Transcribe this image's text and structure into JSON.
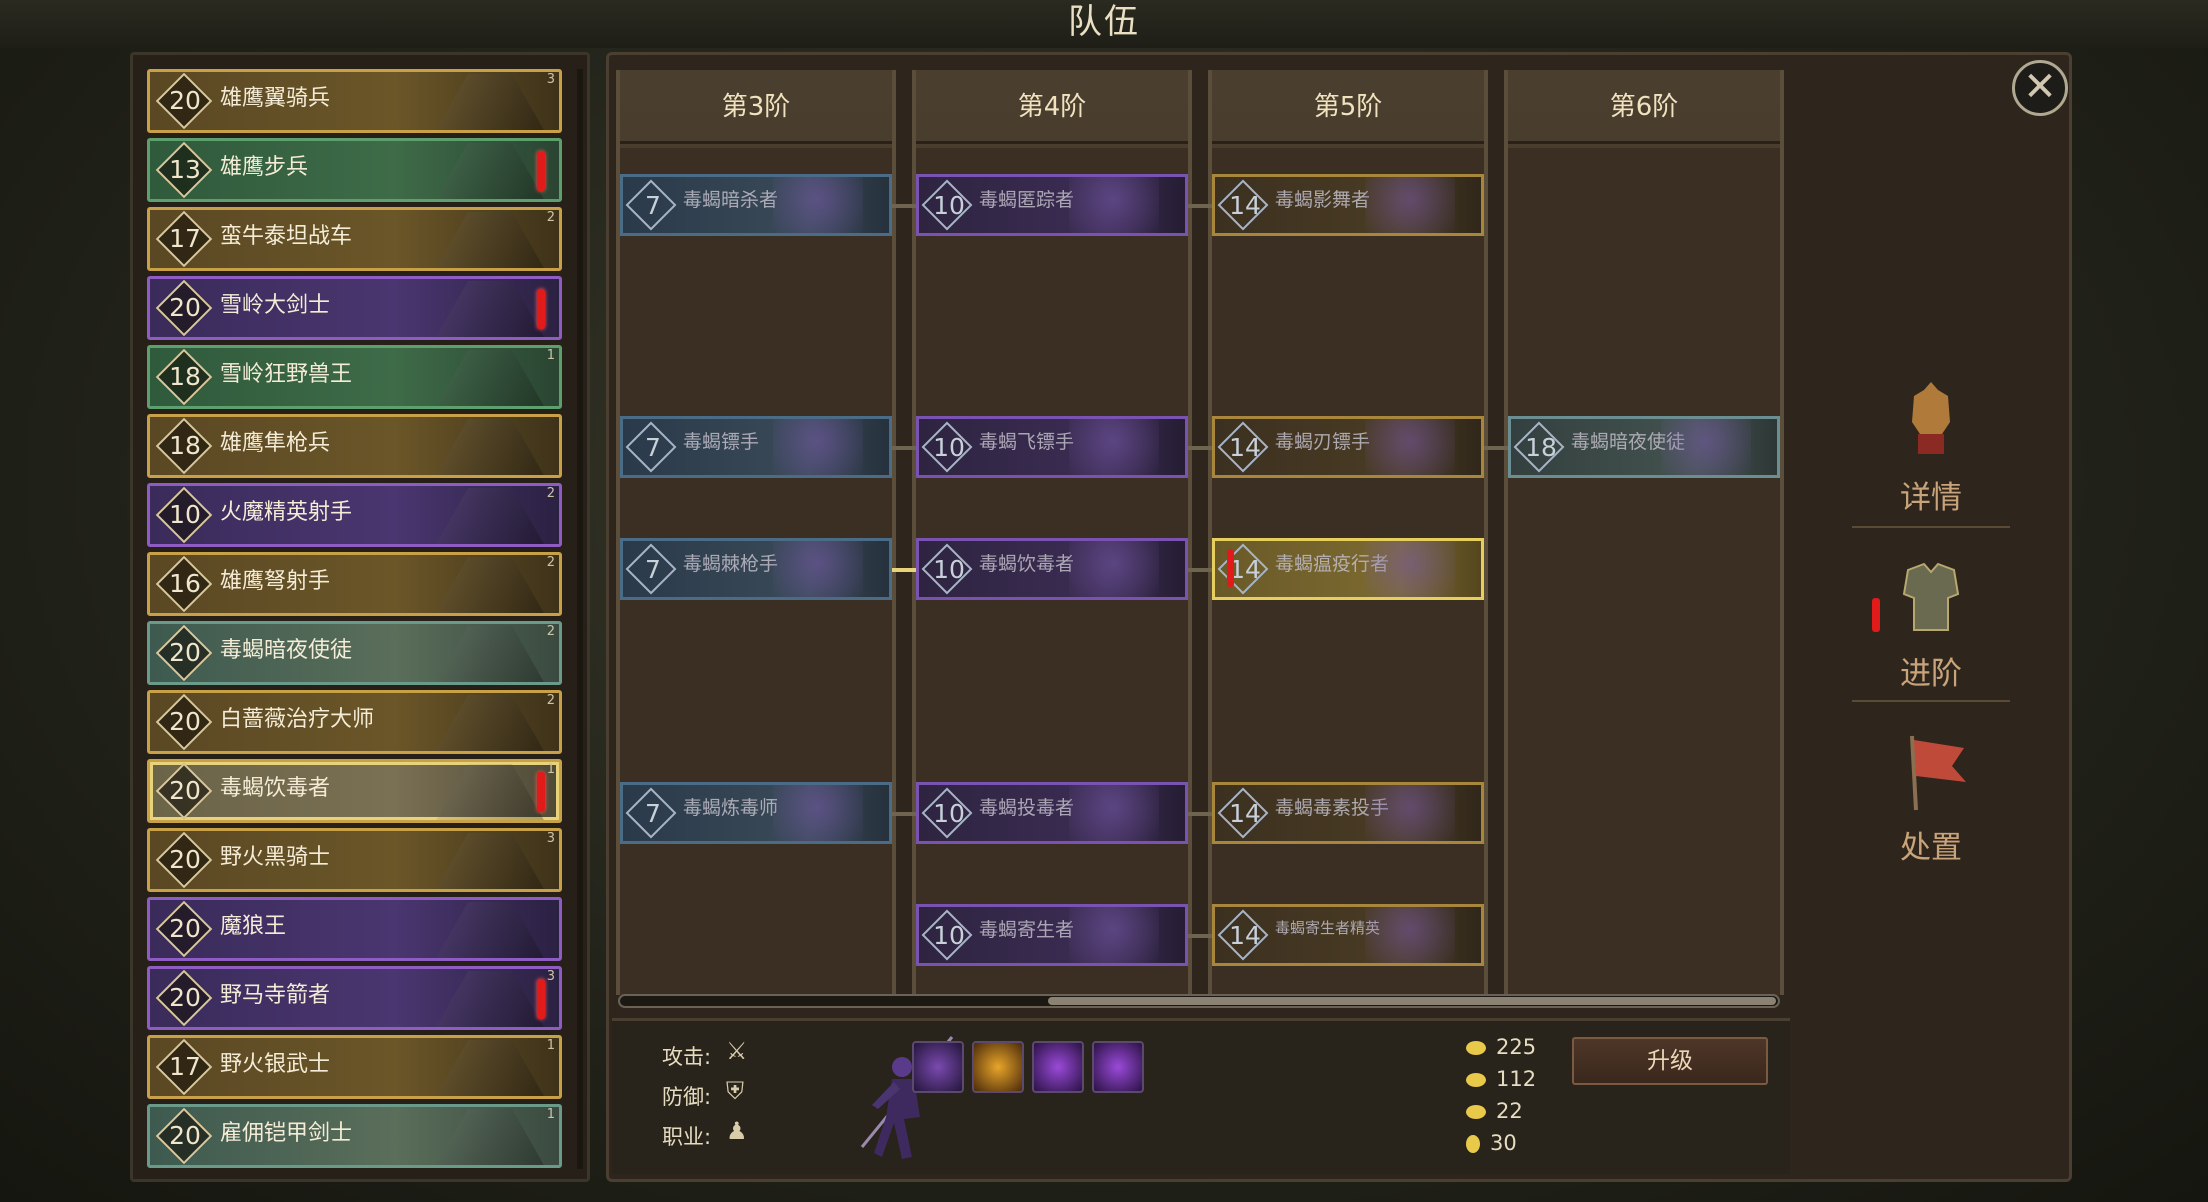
{
  "header": {
    "title": "队伍"
  },
  "roster": [
    {
      "level": "20",
      "name": "雄鹰翼骑兵",
      "stars": "3",
      "rarity": "gold",
      "alert": false
    },
    {
      "level": "13",
      "name": "雄鹰步兵",
      "stars": "",
      "rarity": "green",
      "alert": true
    },
    {
      "level": "17",
      "name": "蛮牛泰坦战车",
      "stars": "2",
      "rarity": "gold",
      "alert": false
    },
    {
      "level": "20",
      "name": "雪岭大剑士",
      "stars": "",
      "rarity": "purple",
      "alert": true
    },
    {
      "level": "18",
      "name": "雪岭狂野兽王",
      "stars": "1",
      "rarity": "green",
      "alert": false
    },
    {
      "level": "18",
      "name": "雄鹰隼枪兵",
      "stars": "",
      "rarity": "gold",
      "alert": false
    },
    {
      "level": "10",
      "name": "火魔精英射手",
      "stars": "2",
      "rarity": "purple",
      "alert": false
    },
    {
      "level": "16",
      "name": "雄鹰弩射手",
      "stars": "2",
      "rarity": "gold",
      "alert": false
    },
    {
      "level": "20",
      "name": "毒蝎暗夜使徒",
      "stars": "2",
      "rarity": "teal",
      "alert": false
    },
    {
      "level": "20",
      "name": "白蔷薇治疗大师",
      "stars": "2",
      "rarity": "gold",
      "alert": false
    },
    {
      "level": "20",
      "name": "毒蝎饮毒者",
      "stars": "1",
      "rarity": "selected",
      "alert": true
    },
    {
      "level": "20",
      "name": "野火黑骑士",
      "stars": "3",
      "rarity": "gold",
      "alert": false
    },
    {
      "level": "20",
      "name": "魔狼王",
      "stars": "",
      "rarity": "purple",
      "alert": false
    },
    {
      "level": "20",
      "name": "野马寺箭者",
      "stars": "3",
      "rarity": "purple",
      "alert": true
    },
    {
      "level": "17",
      "name": "野火银武士",
      "stars": "1",
      "rarity": "gold",
      "alert": false
    },
    {
      "level": "20",
      "name": "雇佣铠甲剑士",
      "stars": "1",
      "rarity": "teal",
      "alert": false
    }
  ],
  "tiers": [
    {
      "label": "第3阶",
      "nodes": [
        {
          "level": "7",
          "name": "毒蝎暗杀者",
          "row": 0,
          "style": ""
        },
        {
          "level": "7",
          "name": "毒蝎镖手",
          "row": 2,
          "style": ""
        },
        {
          "level": "7",
          "name": "毒蝎棘枪手",
          "row": 3,
          "style": ""
        },
        {
          "level": "7",
          "name": "毒蝎炼毒师",
          "row": 5,
          "style": ""
        }
      ]
    },
    {
      "label": "第4阶",
      "nodes": [
        {
          "level": "10",
          "name": "毒蝎匿踪者",
          "row": 0,
          "style": "purple"
        },
        {
          "level": "10",
          "name": "毒蝎飞镖手",
          "row": 2,
          "style": "purple"
        },
        {
          "level": "10",
          "name": "毒蝎饮毒者",
          "row": 3,
          "style": "purple"
        },
        {
          "level": "10",
          "name": "毒蝎投毒者",
          "row": 5,
          "style": "purple"
        },
        {
          "level": "10",
          "name": "毒蝎寄生者",
          "row": 6,
          "style": "purple"
        }
      ]
    },
    {
      "label": "第5阶",
      "nodes": [
        {
          "level": "14",
          "name": "毒蝎影舞者",
          "row": 0,
          "style": "gold"
        },
        {
          "level": "14",
          "name": "毒蝎刃镖手",
          "row": 2,
          "style": "gold"
        },
        {
          "level": "14",
          "name": "毒蝎瘟疫行者",
          "row": 3,
          "style": "active"
        },
        {
          "level": "14",
          "name": "毒蝎毒素投手",
          "row": 5,
          "style": "gold"
        },
        {
          "level": "14",
          "name": "毒蝎寄生者精英",
          "row": 6,
          "style": "gold"
        }
      ]
    },
    {
      "label": "第6阶",
      "nodes": [
        {
          "level": "18",
          "name": "毒蝎暗夜使徒",
          "row": 2,
          "style": "teal"
        }
      ]
    }
  ],
  "unit_info": {
    "attack_label": "攻击:",
    "defense_label": "防御:",
    "class_label": "职业:",
    "attack_icon": "sword-icon",
    "defense_icon": "shield-icon",
    "class_icon": "helmet-icon"
  },
  "resources": [
    {
      "value": "225",
      "icon": "gold-coin-icon"
    },
    {
      "value": "112",
      "icon": "ingot-icon"
    },
    {
      "value": "22",
      "icon": "gold-bar-icon"
    },
    {
      "value": "30",
      "icon": "crystal-drop-icon"
    }
  ],
  "actions": {
    "upgrade": "升级",
    "details": "详情",
    "advance": "进阶",
    "dispose": "处置"
  },
  "colors": {
    "alert": "#e11a1a",
    "selected": "#e8d27a",
    "side_label": "#c9a47a"
  }
}
